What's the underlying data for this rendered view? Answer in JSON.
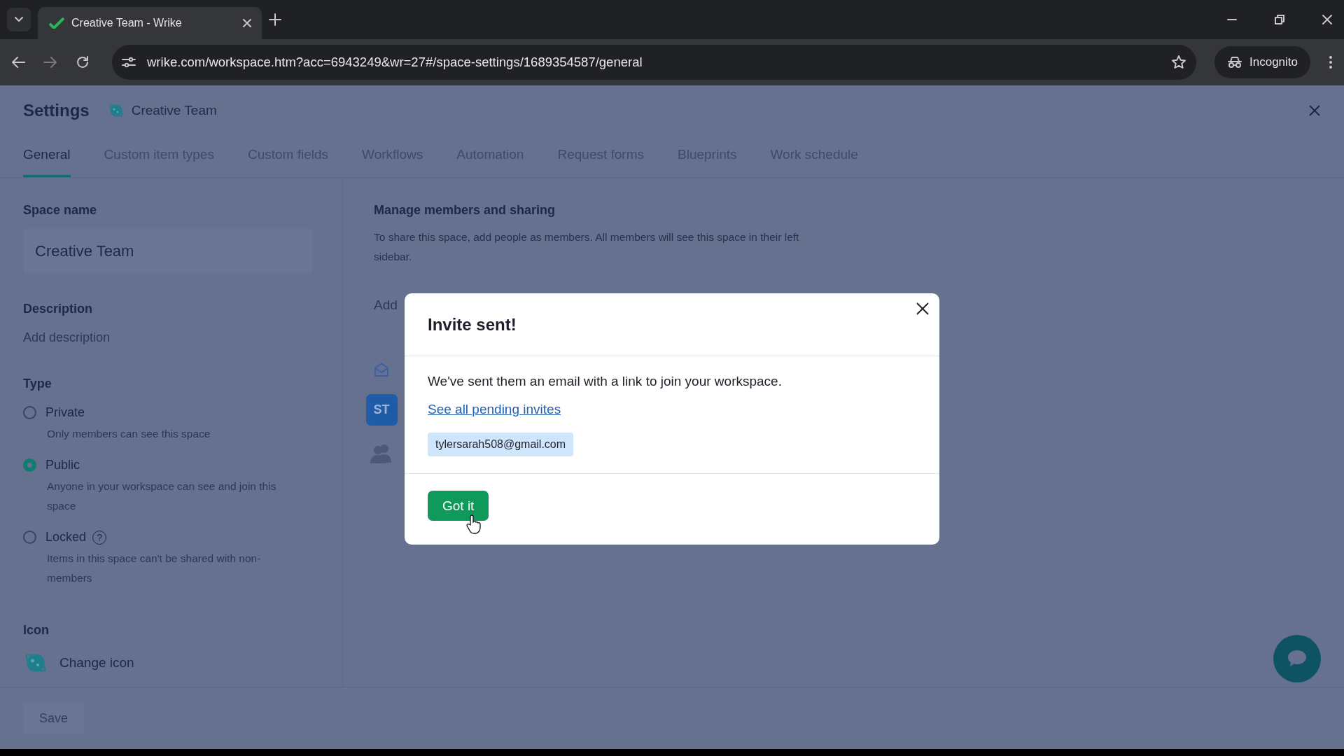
{
  "browser": {
    "tab_title": "Creative Team - Wrike",
    "url": "wrike.com/workspace.htm?acc=6943249&wr=27#/space-settings/1689354587/general",
    "incognito_label": "Incognito"
  },
  "settings": {
    "title": "Settings",
    "space_title": "Creative Team",
    "tabs": [
      {
        "label": "General",
        "selected": true
      },
      {
        "label": "Custom item types",
        "selected": false
      },
      {
        "label": "Custom fields",
        "selected": false
      },
      {
        "label": "Workflows",
        "selected": false
      },
      {
        "label": "Automation",
        "selected": false
      },
      {
        "label": "Request forms",
        "selected": false
      },
      {
        "label": "Blueprints",
        "selected": false
      },
      {
        "label": "Work schedule",
        "selected": false
      }
    ]
  },
  "general": {
    "space_name_label": "Space name",
    "space_name_value": "Creative Team",
    "description_label": "Description",
    "description_placeholder": "Add description",
    "type_label": "Type",
    "type_options": [
      {
        "label": "Private",
        "description": "Only members can see this space",
        "selected": false
      },
      {
        "label": "Public",
        "description": "Anyone in your workspace can see and join this space",
        "selected": true
      },
      {
        "label": "Locked",
        "description": "Items in this space can't be shared with non-members",
        "selected": false,
        "help": "?"
      }
    ],
    "icon_label": "Icon",
    "change_icon_label": "Change icon"
  },
  "members": {
    "heading": "Manage members and sharing",
    "description": "To share this space, add people as members. All members will see this space in their left sidebar.",
    "add_placeholder": "Add",
    "avatar_initials": "ST"
  },
  "save_button": {
    "label": "Save",
    "disabled": true
  },
  "modal": {
    "title": "Invite sent!",
    "message": "We've sent them an email with a link to join your workspace.",
    "link": "See all pending invites",
    "email_chip": "tylersarah508@gmail.com",
    "button": "Got it"
  }
}
